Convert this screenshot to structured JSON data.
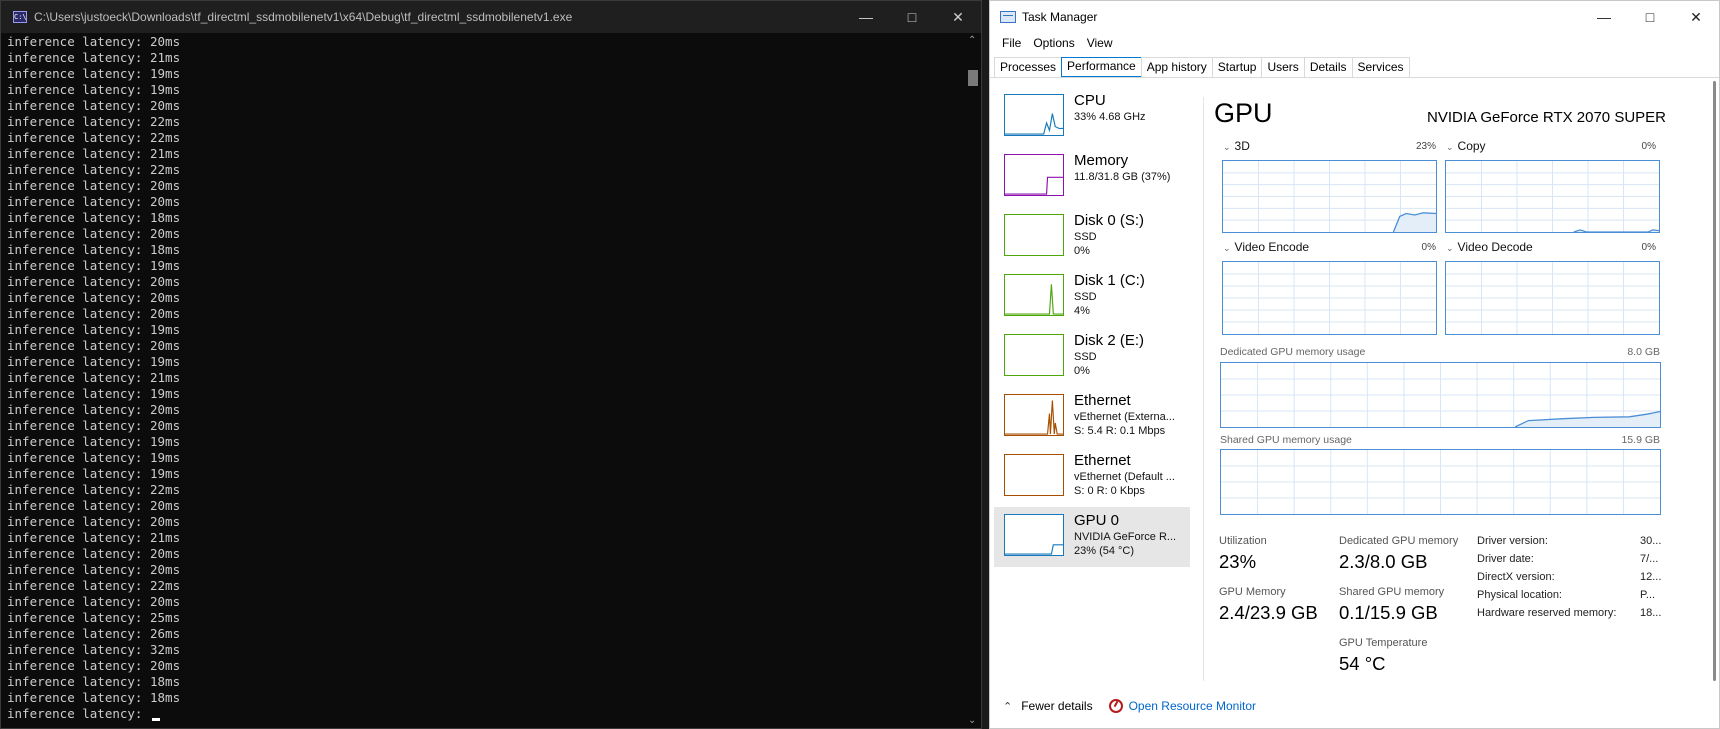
{
  "console": {
    "title": "C:\\Users\\justoeck\\Downloads\\tf_directml_ssdmobilenetv1\\x64\\Debug\\tf_directml_ssdmobilenetv1.exe",
    "lines": [
      "inference latency: 20ms",
      "inference latency: 21ms",
      "inference latency: 19ms",
      "inference latency: 19ms",
      "inference latency: 20ms",
      "inference latency: 22ms",
      "inference latency: 22ms",
      "inference latency: 21ms",
      "inference latency: 22ms",
      "inference latency: 20ms",
      "inference latency: 20ms",
      "inference latency: 18ms",
      "inference latency: 20ms",
      "inference latency: 18ms",
      "inference latency: 19ms",
      "inference latency: 20ms",
      "inference latency: 20ms",
      "inference latency: 20ms",
      "inference latency: 19ms",
      "inference latency: 20ms",
      "inference latency: 19ms",
      "inference latency: 21ms",
      "inference latency: 19ms",
      "inference latency: 20ms",
      "inference latency: 20ms",
      "inference latency: 19ms",
      "inference latency: 19ms",
      "inference latency: 19ms",
      "inference latency: 22ms",
      "inference latency: 20ms",
      "inference latency: 20ms",
      "inference latency: 21ms",
      "inference latency: 20ms",
      "inference latency: 20ms",
      "inference latency: 22ms",
      "inference latency: 20ms",
      "inference latency: 25ms",
      "inference latency: 26ms",
      "inference latency: 32ms",
      "inference latency: 20ms",
      "inference latency: 18ms",
      "inference latency: 18ms"
    ],
    "prompt": "inference latency: "
  },
  "taskmanager": {
    "title": "Task Manager",
    "menu": [
      "File",
      "Options",
      "View"
    ],
    "tabs": [
      "Processes",
      "Performance",
      "App history",
      "Startup",
      "Users",
      "Details",
      "Services"
    ],
    "active_tab": "Performance",
    "resources": [
      {
        "name": "CPU",
        "sub1": "33%  4.68 GHz",
        "sub2": "",
        "color": "#1779ba",
        "kind": "cpu",
        "selected": false
      },
      {
        "name": "Memory",
        "sub1": "11.8/31.8 GB (37%)",
        "sub2": "",
        "color": "#8b12ae",
        "kind": "mem",
        "selected": false
      },
      {
        "name": "Disk 0 (S:)",
        "sub1": "SSD",
        "sub2": "0%",
        "color": "#4da60c",
        "kind": "flat",
        "selected": false
      },
      {
        "name": "Disk 1 (C:)",
        "sub1": "SSD",
        "sub2": "4%",
        "color": "#4da60c",
        "kind": "disk1",
        "selected": false
      },
      {
        "name": "Disk 2 (E:)",
        "sub1": "SSD",
        "sub2": "0%",
        "color": "#4da60c",
        "kind": "flat",
        "selected": false
      },
      {
        "name": "Ethernet",
        "sub1": "vEthernet (Externa...",
        "sub2": "S: 5.4  R: 0.1 Mbps",
        "color": "#a74f01",
        "kind": "eth",
        "selected": false
      },
      {
        "name": "Ethernet",
        "sub1": "vEthernet (Default ...",
        "sub2": "S: 0  R: 0 Kbps",
        "color": "#a74f01",
        "kind": "flat",
        "selected": false
      },
      {
        "name": "GPU 0",
        "sub1": "NVIDIA GeForce R...",
        "sub2": "23%  (54 °C)",
        "color": "#1779ba",
        "kind": "gpu",
        "selected": true
      }
    ],
    "gpu": {
      "title": "GPU",
      "model": "NVIDIA GeForce RTX 2070 SUPER",
      "engines": [
        {
          "label": "3D",
          "pct": "23%"
        },
        {
          "label": "Copy",
          "pct": "0%"
        },
        {
          "label": "Video Encode",
          "pct": "0%"
        },
        {
          "label": "Video Decode",
          "pct": "0%"
        }
      ],
      "dedicated_label": "Dedicated GPU memory usage",
      "dedicated_max": "8.0 GB",
      "shared_label": "Shared GPU memory usage",
      "shared_max": "15.9 GB",
      "stats": {
        "utilization_label": "Utilization",
        "utilization": "23%",
        "dedicated_label": "Dedicated GPU memory",
        "dedicated": "2.3/8.0 GB",
        "gpu_memory_label": "GPU Memory",
        "gpu_memory": "2.4/23.9 GB",
        "shared_label": "Shared GPU memory",
        "shared": "0.1/15.9 GB",
        "temp_label": "GPU Temperature",
        "temp": "54 °C"
      },
      "info": [
        {
          "k": "Driver version:",
          "v": "30..."
        },
        {
          "k": "Driver date:",
          "v": "7/..."
        },
        {
          "k": "DirectX version:",
          "v": "12..."
        },
        {
          "k": "Physical location:",
          "v": "P..."
        },
        {
          "k": "Hardware reserved memory:",
          "v": "18..."
        }
      ]
    },
    "footer": {
      "fewer": "Fewer details",
      "monitor": "Open Resource Monitor"
    },
    "accent": "#0078d4",
    "graph_color": "#4a8fd6"
  }
}
